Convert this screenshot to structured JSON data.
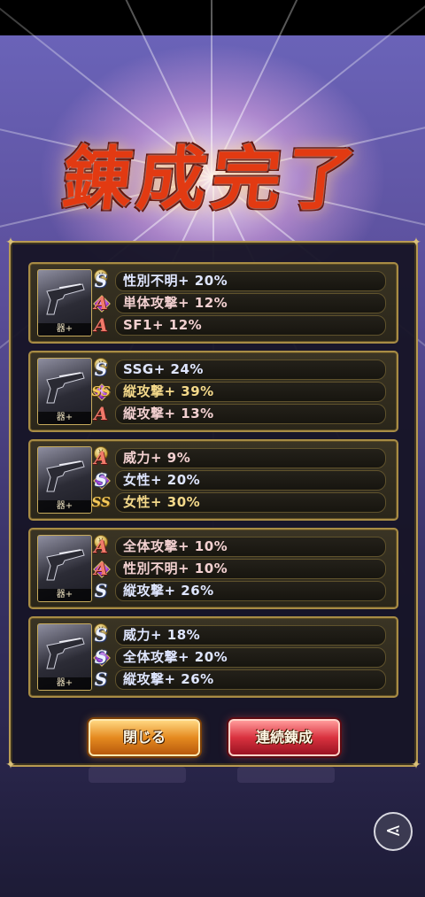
{
  "title": "錬成完了",
  "thumb_label": "器+",
  "icons": {
    "coin": "gold-coin-icon",
    "gem": "purple-gem-icon",
    "weapon": "handgun-icon",
    "share": "share-icon"
  },
  "results": [
    {
      "stats": [
        {
          "rank": "S",
          "text": "性別不明+ 20%"
        },
        {
          "rank": "A",
          "text": "単体攻撃+ 12%"
        },
        {
          "rank": "A",
          "text": "SF1+ 12%"
        }
      ]
    },
    {
      "stats": [
        {
          "rank": "S",
          "text": "SSG+ 24%"
        },
        {
          "rank": "SS",
          "text": "縦攻撃+ 39%"
        },
        {
          "rank": "A",
          "text": "縦攻撃+ 13%"
        }
      ]
    },
    {
      "stats": [
        {
          "rank": "A",
          "text": "威力+ 9%"
        },
        {
          "rank": "S",
          "text": "女性+ 20%"
        },
        {
          "rank": "SS",
          "text": "女性+ 30%"
        }
      ]
    },
    {
      "stats": [
        {
          "rank": "A",
          "text": "全体攻撃+ 10%"
        },
        {
          "rank": "A",
          "text": "性別不明+ 10%"
        },
        {
          "rank": "S",
          "text": "縦攻撃+ 26%"
        }
      ]
    },
    {
      "stats": [
        {
          "rank": "S",
          "text": "威力+ 18%"
        },
        {
          "rank": "S",
          "text": "全体攻撃+ 20%"
        },
        {
          "rank": "S",
          "text": "縦攻撃+ 26%"
        }
      ]
    }
  ],
  "buttons": {
    "close": "閉じる",
    "continue": "連続錬成"
  },
  "colors": {
    "title": "#e23a12",
    "rank_s": "#eef2ff",
    "rank_a": "#f07a6a",
    "rank_ss": "#f4c95a",
    "frame_gold": "#b89a52"
  }
}
